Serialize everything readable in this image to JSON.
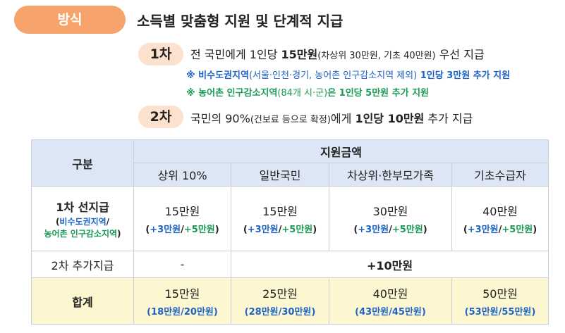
{
  "method_label": "방식",
  "title": "소득별 맞춤형 지원 및 단계적 지급",
  "round1": {
    "label": "1차",
    "pre": "전 국민에게 1인당 ",
    "amount": "15만원",
    "paren": "(차상위 30만원, 기초 40만원)",
    "post": " 우선 지급",
    "note1_a": "※ 비수도권지역",
    "note1_b": "(서울·인천·경기, 농어촌 인구감소지역 제외)",
    "note1_c": " 1인당 3만원 추가 지원",
    "note2_a": "※ 농어촌 인구감소지역",
    "note2_b": "(84개 시·군)",
    "note2_c": "은 1인당 5만원 추가 지원"
  },
  "round2": {
    "label": "2차",
    "pre": "국민의 90%",
    "paren": "(건보료 등으로 확정)",
    "mid": "에게 ",
    "amount": "1인당 10만원",
    "post": " 추가 지급"
  },
  "table": {
    "col_header": "구분",
    "group_header": "지원금액",
    "columns": [
      "상위 10%",
      "일반국민",
      "차상위·한부모가족",
      "기초수급자"
    ],
    "row1": {
      "label": "1차 선지급",
      "sub_open": "(",
      "sub_blue": "비수도권지역",
      "sub_slash": "/",
      "sub_green": "농어촌 인구감소지역",
      "sub_close": ")",
      "cells": [
        {
          "value": "15만원",
          "a": "+3만원",
          "b": "+5만원"
        },
        {
          "value": "15만원",
          "a": "+3만원",
          "b": "+5만원"
        },
        {
          "value": "30만원",
          "a": "+3만원",
          "b": "+5만원"
        },
        {
          "value": "40만원",
          "a": "+3만원",
          "b": "+5만원"
        }
      ]
    },
    "row2": {
      "label": "2차 추가지급",
      "first": "-",
      "merged": "+10만원"
    },
    "row3": {
      "label": "합계",
      "cells": [
        {
          "value": "15만원",
          "a": "18만원",
          "b": "20만원"
        },
        {
          "value": "25만원",
          "a": "28만원",
          "b": "30만원"
        },
        {
          "value": "40만원",
          "a": "43만원",
          "b": "45만원"
        },
        {
          "value": "50만원",
          "a": "53만원",
          "b": "55만원"
        }
      ]
    }
  },
  "colors": {
    "accent": "#f7a36c",
    "blue": "#1d63c4",
    "green": "#1a9a55",
    "header_bg": "#dde6f5",
    "sum_bg": "#fcf7d1"
  }
}
